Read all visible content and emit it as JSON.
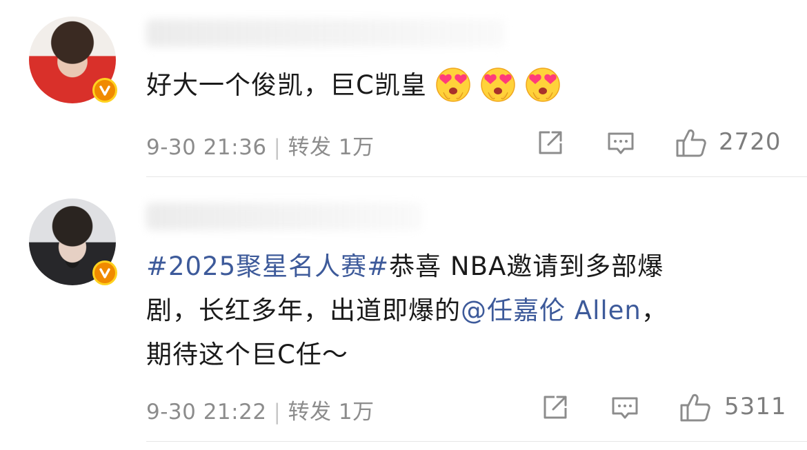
{
  "comments": [
    {
      "text": "好大一个俊凯，巨C凯皇",
      "emojis": [
        "heart-eyes-emoji",
        "heart-eyes-emoji",
        "heart-eyes-emoji"
      ],
      "time": "9-30 21:36",
      "repost_label": "转发",
      "repost_count": "1万",
      "like_count": "2720"
    },
    {
      "hashtag": "#2025聚星名人赛#",
      "line1_rest": "恭喜 NBA邀请到多部爆",
      "line2_text": "剧，长红多年，出道即爆的",
      "mention": "@任嘉伦 Allen",
      "line2_end": "，",
      "line3": "期待这个巨C任～",
      "time": "9-30 21:22",
      "repost_label": "转发",
      "repost_count": "1万",
      "like_count": "5311"
    }
  ],
  "colors": {
    "link": "#3d5a9a",
    "meta": "#8c8c8c",
    "badge": "#f08a00"
  }
}
